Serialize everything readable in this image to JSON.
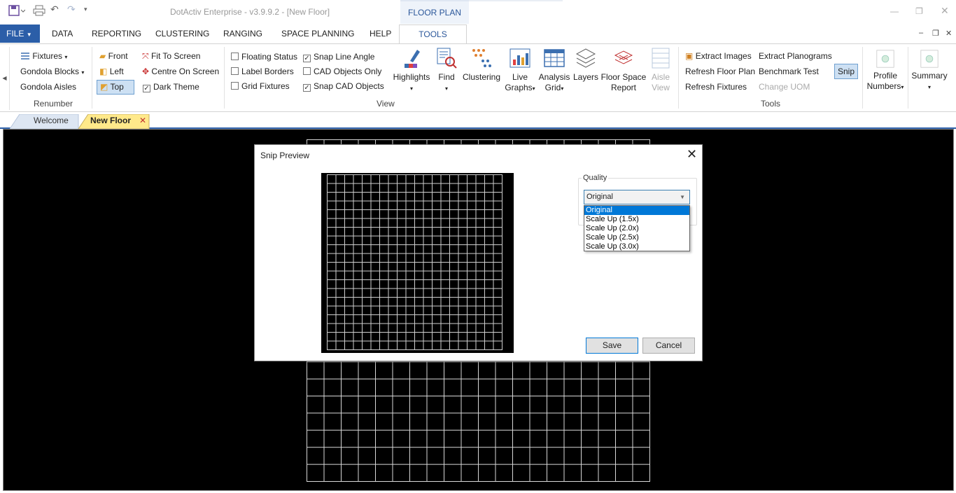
{
  "title_bar": {
    "app_title": "DotActiv Enterprise - v3.9.9.2 - [New Floor]",
    "context_tab": "FLOOR PLAN",
    "qat_icons": [
      "save-icon",
      "print-icon",
      "undo-icon",
      "redo-icon",
      "customize-icon"
    ]
  },
  "ribbon_tabs": {
    "file": "FILE",
    "tabs": [
      "DATA",
      "REPORTING",
      "CLUSTERING",
      "RANGING",
      "SPACE PLANNING",
      "HELP"
    ],
    "active": "TOOLS"
  },
  "ribbon": {
    "renumber": {
      "items": [
        "Fixtures",
        "Gondola Blocks",
        "Gondola Aisles"
      ],
      "group_label": "Renumber"
    },
    "view_dir": {
      "front": "Front",
      "left": "Left",
      "top": "Top"
    },
    "view_opts": {
      "fit_to_screen": "Fit To Screen",
      "centre_on_screen": "Centre On Screen",
      "dark_theme": "Dark Theme"
    },
    "checks": [
      {
        "label": "Floating Status",
        "checked": false
      },
      {
        "label": "Label Borders",
        "checked": false
      },
      {
        "label": "Grid Fixtures",
        "checked": false
      },
      {
        "label": "Snap Line Angle",
        "checked": true
      },
      {
        "label": "CAD Objects Only",
        "checked": false
      },
      {
        "label": "Snap CAD Objects",
        "checked": true
      }
    ],
    "big_buttons": {
      "highlights": "Highlights",
      "find": "Find",
      "clustering": "Clustering",
      "live_graphs_1": "Live",
      "live_graphs_2": "Graphs",
      "analysis_grid_1": "Analysis",
      "analysis_grid_2": "Grid",
      "layers": "Layers",
      "floor_space_1": "Floor Space",
      "floor_space_2": "Report",
      "aisle_view_1": "Aisle",
      "aisle_view_2": "View"
    },
    "view_group_label": "View",
    "tools": {
      "extract_images": "Extract Images",
      "refresh_floor_plan": "Refresh Floor Plan",
      "refresh_fixtures": "Refresh Fixtures",
      "extract_planograms": "Extract Planograms",
      "benchmark_test": "Benchmark Test",
      "change_uom": "Change UOM",
      "snip": "Snip",
      "group_label": "Tools"
    },
    "profile_numbers_1": "Profile",
    "profile_numbers_2": "Numbers",
    "summary": "Summary"
  },
  "doc_tabs": {
    "welcome": "Welcome",
    "new_floor": "New Floor"
  },
  "dialog": {
    "title": "Snip Preview",
    "quality_label": "Quality",
    "quality_value": "Original",
    "options": [
      "Original",
      "Scale Up (1.5x)",
      "Scale Up (2.0x)",
      "Scale Up (2.5x)",
      "Scale Up (3.0x)"
    ],
    "selected_option": "Original",
    "save": "Save",
    "cancel": "Cancel"
  },
  "colors": {
    "file_tab": "#2b5ea8",
    "accent": "#2b579a",
    "active_doc_tab": "#ffe98a",
    "canvas": "#000000",
    "dropdown_selection": "#0078d7"
  }
}
